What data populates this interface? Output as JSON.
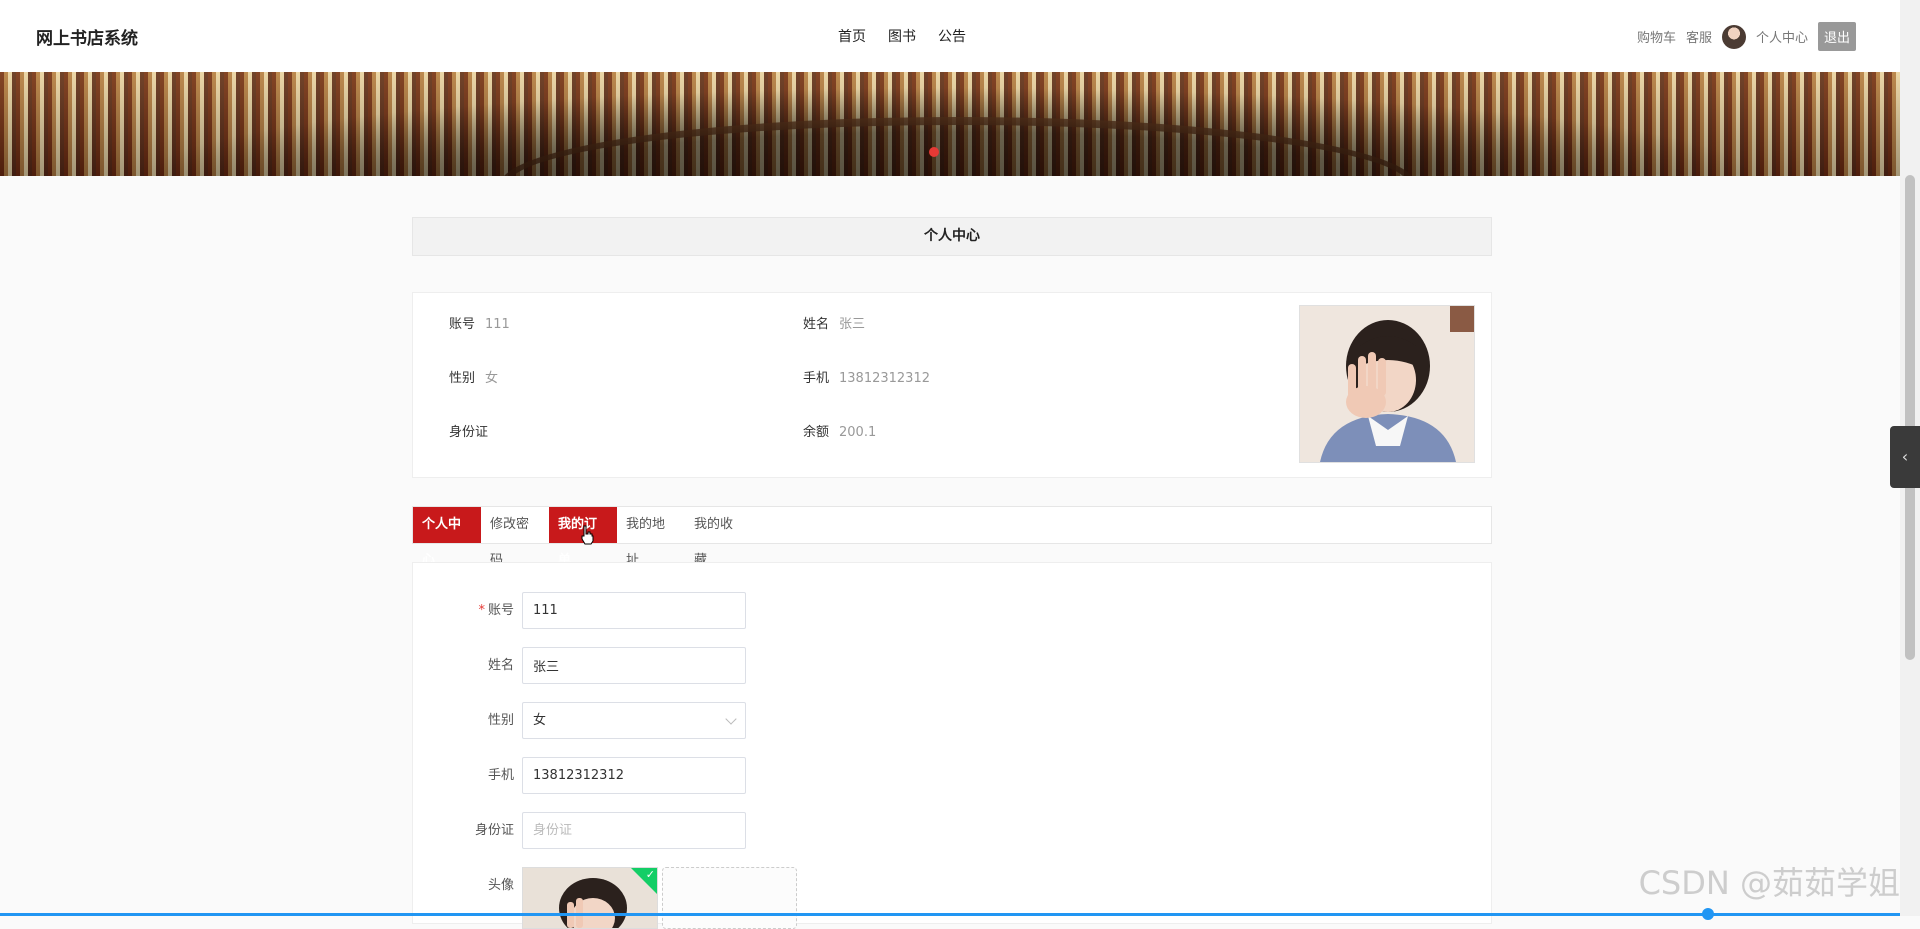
{
  "app": {
    "title": "网上书店系统"
  },
  "nav": {
    "items": [
      "首页",
      "图书",
      "公告"
    ]
  },
  "userbar": {
    "cart": "购物车",
    "service": "客服",
    "center": "个人中心",
    "logout": "退出"
  },
  "section": {
    "title": "个人中心"
  },
  "profile": {
    "account": {
      "label": "账号",
      "value": "111"
    },
    "name": {
      "label": "姓名",
      "value": "张三"
    },
    "gender": {
      "label": "性别",
      "value": "女"
    },
    "phone": {
      "label": "手机",
      "value": "13812312312"
    },
    "idcard": {
      "label": "身份证",
      "value": ""
    },
    "balance": {
      "label": "余额",
      "value": "200.1"
    }
  },
  "tabs": [
    {
      "label": "个人中心",
      "active": true
    },
    {
      "label": "修改密码",
      "active": false
    },
    {
      "label": "我的订单",
      "active": true
    },
    {
      "label": "我的地址",
      "active": false
    },
    {
      "label": "我的收藏",
      "active": false
    }
  ],
  "form": {
    "account": {
      "label": "账号",
      "required": "*",
      "value": "111"
    },
    "name": {
      "label": "姓名",
      "value": "张三"
    },
    "gender": {
      "label": "性别",
      "value": "女"
    },
    "phone": {
      "label": "手机",
      "value": "13812312312"
    },
    "idcard": {
      "label": "身份证",
      "value": "",
      "placeholder": "身份证"
    },
    "avatar": {
      "label": "头像"
    }
  },
  "colors": {
    "accent": "#c8191b",
    "success": "#13ce66",
    "progress": "#2196f3"
  },
  "watermark": "CSDN @茹茹学姐"
}
